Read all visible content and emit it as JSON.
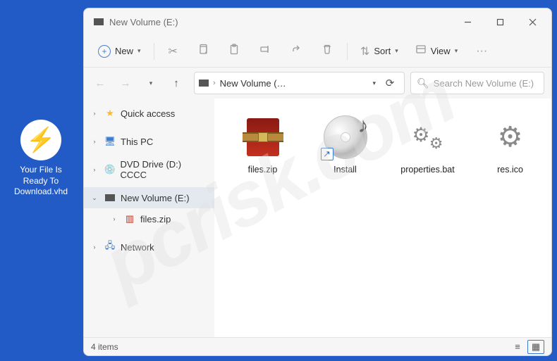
{
  "watermark": "pcrisk.com",
  "desktop": {
    "label": "Your File Is Ready To Download.vhd"
  },
  "window": {
    "title": "New Volume (E:)",
    "toolbar": {
      "new": "New",
      "sort": "Sort",
      "view": "View"
    },
    "address": {
      "path": "New Volume (…",
      "sep": "›"
    },
    "search": {
      "placeholder": "Search New Volume (E:)"
    },
    "sidebar": {
      "items": [
        {
          "label": "Quick access"
        },
        {
          "label": "This PC"
        },
        {
          "label": "DVD Drive (D:) CCCC"
        },
        {
          "label": "New Volume (E:)"
        },
        {
          "label": "files.zip"
        },
        {
          "label": "Network"
        }
      ]
    },
    "content": [
      {
        "label": "files.zip"
      },
      {
        "label": "Install"
      },
      {
        "label": "properties.bat"
      },
      {
        "label": "res.ico"
      }
    ],
    "status": "4 items"
  }
}
